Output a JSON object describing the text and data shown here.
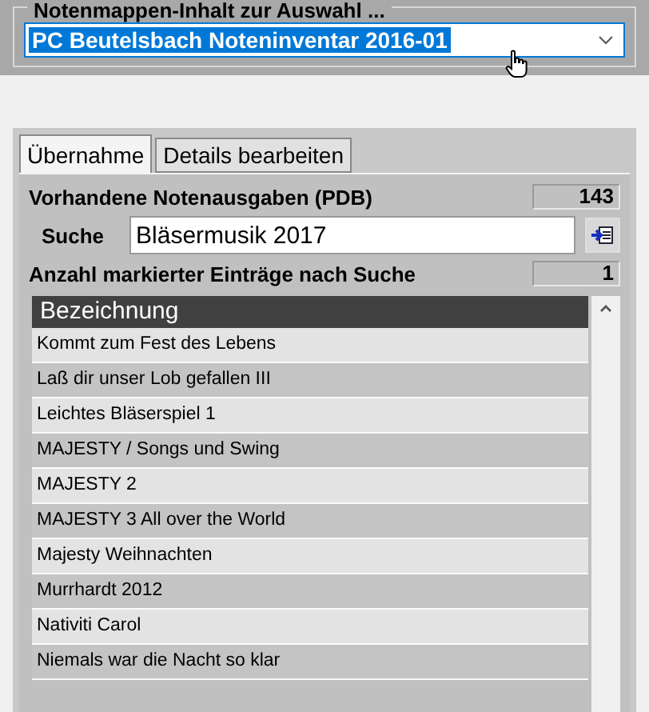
{
  "selection_group": {
    "title": "Notenmappen-Inhalt zur Auswahl ...",
    "dropdown": {
      "value": "PC Beutelsbach Noteninventar 2016-01"
    }
  },
  "tabs": [
    {
      "label": "Übernahme",
      "selected": true
    },
    {
      "label": "Details bearbeiten",
      "selected": false
    }
  ],
  "available": {
    "label": "Vorhandene Notenausgaben (PDB)",
    "count": "143"
  },
  "search": {
    "label": "Suche",
    "value": "Bläsermusik 2017"
  },
  "marked": {
    "label": "Anzahl markierter Einträge nach Suche",
    "count": "1"
  },
  "table": {
    "columns": [
      "Bezeichnung"
    ],
    "rows": [
      {
        "cells": [
          "Kommt zum Fest des Lebens"
        ]
      },
      {
        "cells": [
          "Laß dir unser Lob gefallen III"
        ]
      },
      {
        "cells": [
          "Leichtes Bläserspiel 1"
        ]
      },
      {
        "cells": [
          "MAJESTY / Songs und Swing"
        ]
      },
      {
        "cells": [
          "MAJESTY 2"
        ]
      },
      {
        "cells": [
          "MAJESTY 3 All over the World"
        ]
      },
      {
        "cells": [
          "Majesty Weihnachten"
        ]
      },
      {
        "cells": [
          "Murrhardt 2012"
        ]
      },
      {
        "cells": [
          "Nativiti Carol"
        ]
      },
      {
        "cells": [
          "Niemals war die Nacht so klar"
        ]
      }
    ]
  }
}
